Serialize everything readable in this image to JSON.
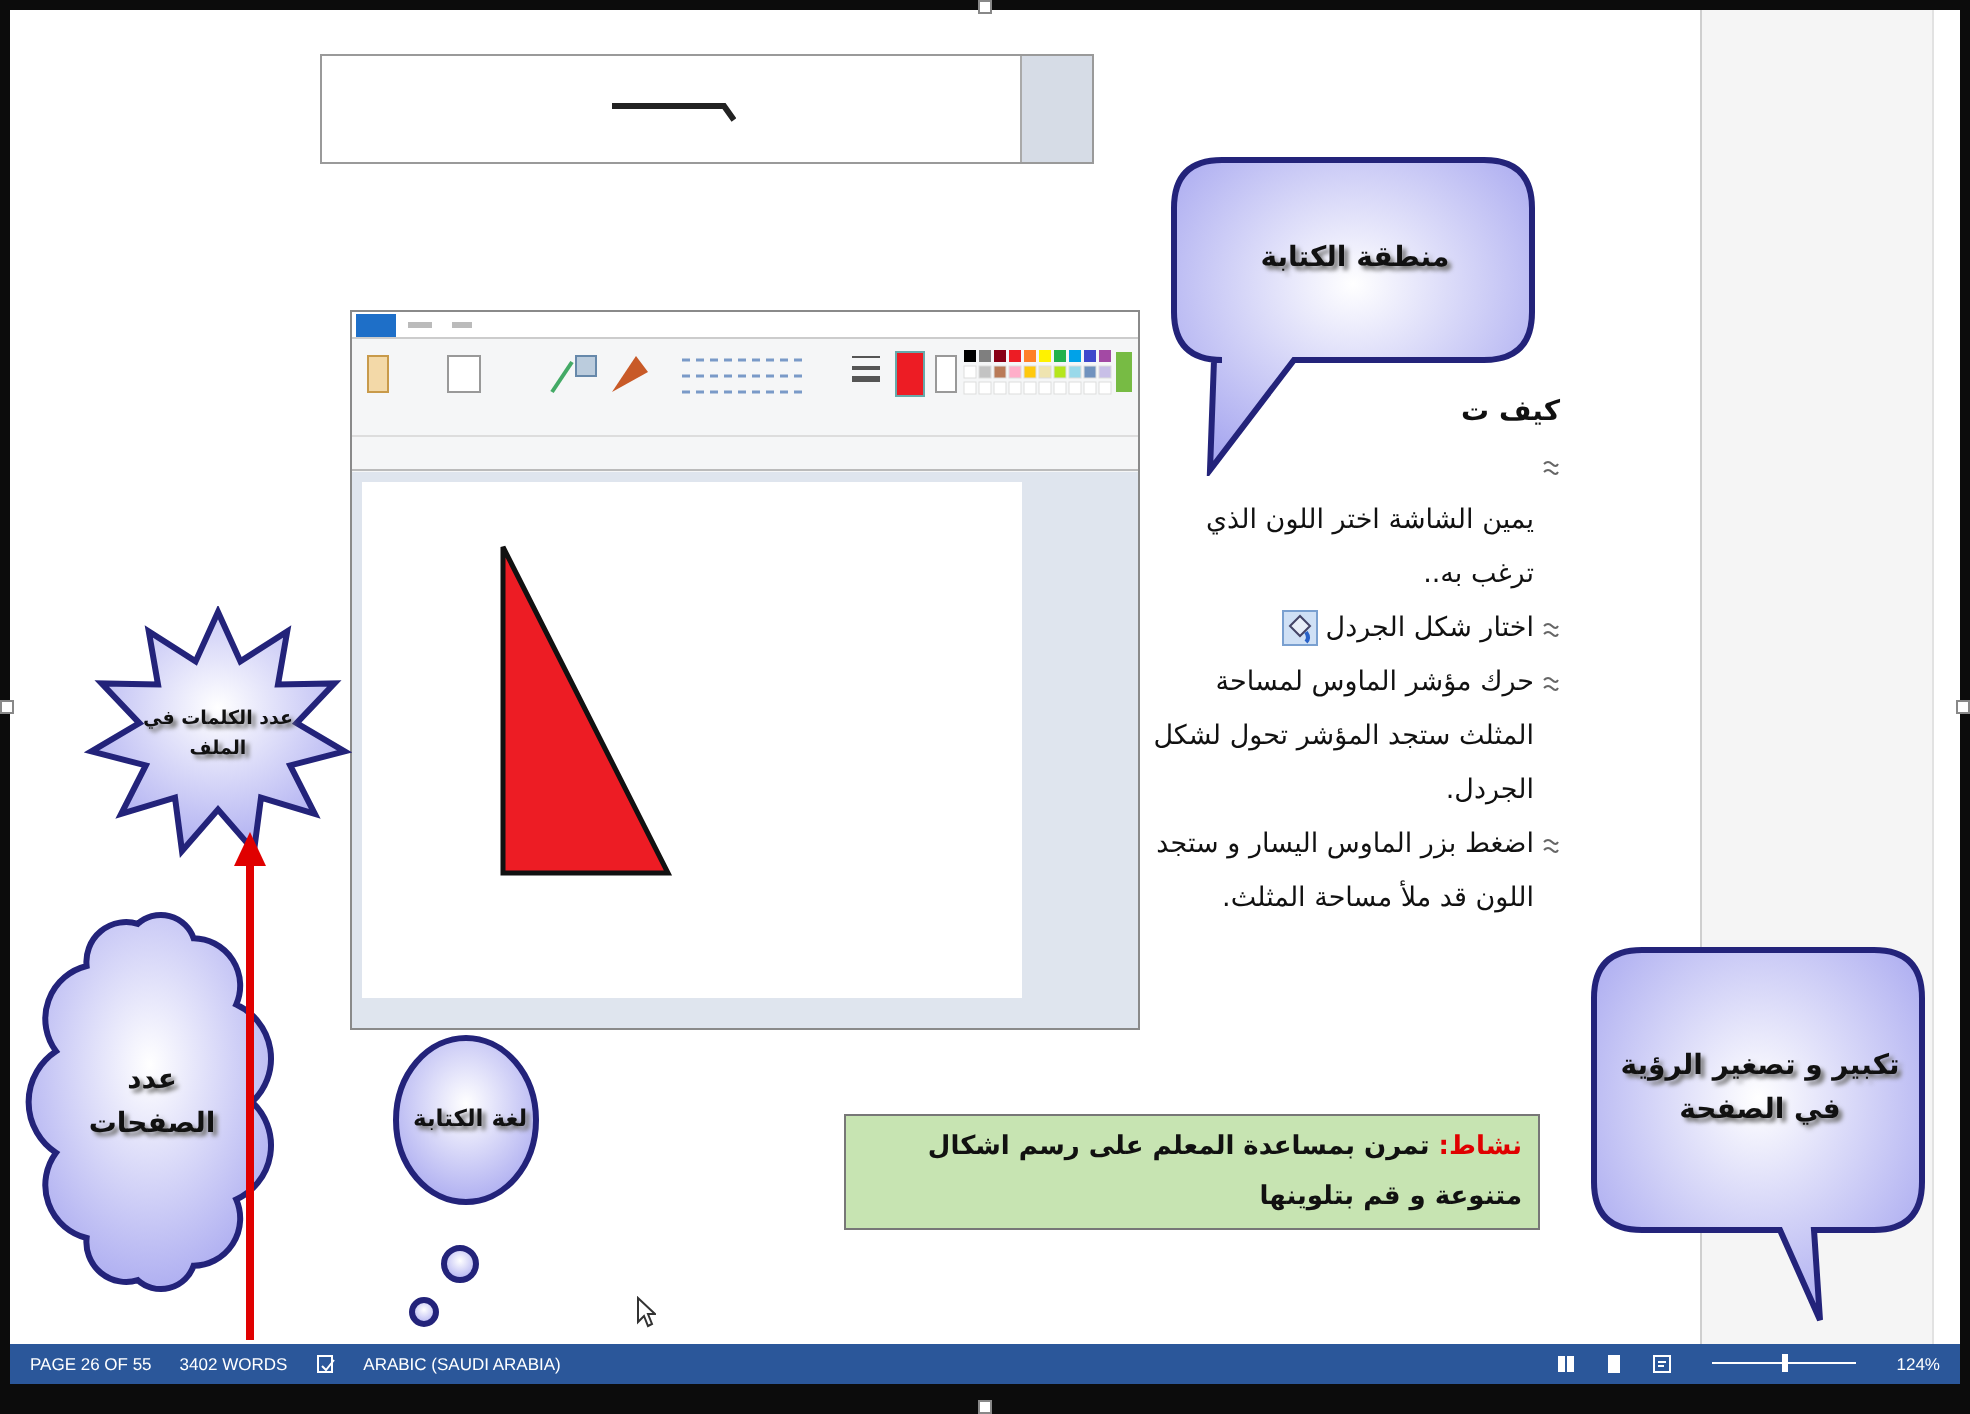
{
  "instructions": {
    "heading": "كيف ت",
    "items": [
      {
        "kind": "partial",
        "text": "يمين الشاشة اختر اللون الذي ترغب به.."
      },
      {
        "kind": "with-icon",
        "text": "اختار شكل الجردل"
      },
      {
        "kind": "plain",
        "text": "حرك مؤشر الماوس لمساحة المثلث ستجد المؤشر تحول لشكل الجردل."
      },
      {
        "kind": "plain",
        "text": "اضغط بزر الماوس اليسار و ستجد اللون قد ملأ مساحة المثلث."
      }
    ]
  },
  "activity": {
    "label": "نشاط:",
    "text": "تمرن بمساعدة المعلم على رسم اشكال متنوعة و قم بتلوينها"
  },
  "callouts": [
    {
      "kind": "speech",
      "lines": [
        "منطقة الكتابة"
      ]
    },
    {
      "kind": "star",
      "lines": [
        "عدد الكلمات في",
        "الملف"
      ]
    },
    {
      "kind": "speech",
      "lines": [
        "تكبير و تصغير الرؤية",
        "في الصفحة"
      ]
    },
    {
      "kind": "thought",
      "lines": [
        "لغة الكتابة"
      ]
    },
    {
      "kind": "cloud",
      "lines": [
        "عدد",
        "الصفحات"
      ]
    }
  ],
  "status_bar": {
    "page": "PAGE 26 OF 55",
    "words": "3402 WORDS",
    "language": "ARABIC (SAUDI ARABIA)",
    "zoom": {
      "level": 0.5,
      "reading": "124%"
    }
  }
}
